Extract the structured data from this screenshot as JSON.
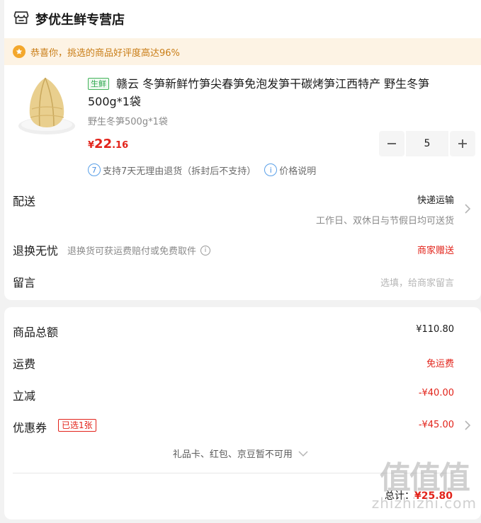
{
  "store": {
    "name": "梦优生鲜专营店",
    "icon": "store-icon"
  },
  "congrats": {
    "text": "恭喜你，挑选的商品好评度高达96%"
  },
  "product": {
    "tag": "生鲜",
    "title": "赣云 冬笋新鲜竹笋尖春笋免泡发笋干碳烤笋江西特产 野生冬笋500g*1袋",
    "spec": "野生冬笋500g*1袋",
    "price_currency": "¥",
    "price_int": "22",
    "price_dec": ".16",
    "quantity": "5",
    "policy_number": "7",
    "policy_text": "支持7天无理由退货（拆封后不支持）",
    "price_note": "价格说明"
  },
  "delivery": {
    "label": "配送",
    "method": "快递运输",
    "note": "工作日、双休日与节假日均可送货"
  },
  "returns": {
    "label": "退换无忧",
    "desc": "退换货可获运费赔付或免费取件",
    "value": "商家赠送"
  },
  "message": {
    "label": "留言",
    "placeholder": "选填，给商家留言"
  },
  "fees": {
    "goods_total_label": "商品总额",
    "goods_total": "¥110.80",
    "shipping_label": "运费",
    "shipping": "免运费",
    "discount_label": "立减",
    "discount": "-¥40.00",
    "coupon_label": "优惠券",
    "coupon_tag": "已选1张",
    "coupon": "-¥45.00",
    "unavailable": "礼品卡、红包、京豆暂不可用",
    "total_label": "总计：",
    "total": "¥25.80"
  },
  "watermark": {
    "big": "值值值",
    "small": "zhizhizhi.com"
  },
  "colors": {
    "price_red": "#e2231a",
    "congrats_orange": "#c97d16",
    "fresh_green": "#2fa84f",
    "info_blue": "#4a90e2"
  }
}
